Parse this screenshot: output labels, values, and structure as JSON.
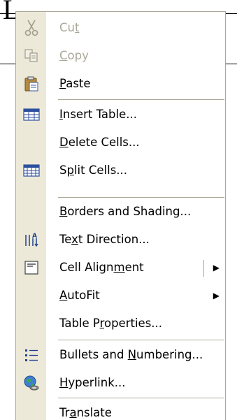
{
  "document": {
    "glyph": "L"
  },
  "context_menu": {
    "items": [
      {
        "label": "Cut",
        "mnemonic_index": 2,
        "icon": "scissors-icon",
        "enabled": false
      },
      {
        "label": "Copy",
        "mnemonic_index": 0,
        "icon": "copy-icon",
        "enabled": false
      },
      {
        "label": "Paste",
        "mnemonic_index": 0,
        "icon": "paste-icon",
        "enabled": true
      },
      {
        "label": "Insert Table...",
        "mnemonic_index": 0,
        "icon": "insert-table-icon",
        "enabled": true
      },
      {
        "label": "Delete Cells...",
        "mnemonic_index": 0,
        "icon": null,
        "enabled": true
      },
      {
        "label": "Split Cells...",
        "mnemonic_index": 1,
        "icon": "split-cells-icon",
        "enabled": true
      },
      {
        "label": "Borders and Shading...",
        "mnemonic_index": 0,
        "icon": null,
        "enabled": true
      },
      {
        "label": "Text Direction...",
        "mnemonic_index": 2,
        "icon": "text-direction-icon",
        "enabled": true
      },
      {
        "label": "Cell Alignment",
        "mnemonic_index": 10,
        "icon": "cell-alignment-icon",
        "enabled": true,
        "submenu": true
      },
      {
        "label": "AutoFit",
        "mnemonic_index": 0,
        "icon": null,
        "enabled": true,
        "submenu": true
      },
      {
        "label": "Table Properties...",
        "mnemonic_index": 7,
        "icon": null,
        "enabled": true
      },
      {
        "label": "Bullets and Numbering...",
        "mnemonic_index": 12,
        "icon": "bullets-icon",
        "enabled": true
      },
      {
        "label": "Hyperlink...",
        "mnemonic_index": 0,
        "icon": "hyperlink-icon",
        "enabled": true
      },
      {
        "label": "Translate",
        "mnemonic_index": 2,
        "icon": null,
        "enabled": true
      }
    ],
    "colors": {
      "gutter": "#ece9d8",
      "disabled_text": "#aca899",
      "separator": "#aca899"
    }
  }
}
